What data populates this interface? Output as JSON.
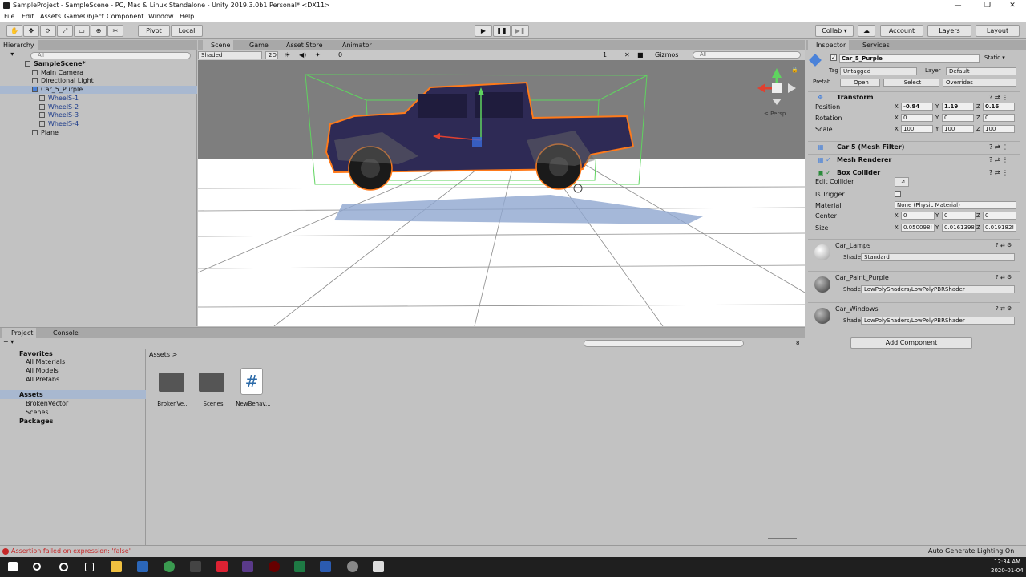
{
  "window": {
    "title": "SampleProject - SampleScene - PC, Mac & Linux Standalone - Unity 2019.3.0b1 Personal* <DX11>",
    "minimize": "—",
    "maximize": "❐",
    "close": "✕"
  },
  "menu": [
    "File",
    "Edit",
    "Assets",
    "GameObject",
    "Component",
    "Window",
    "Help"
  ],
  "toolbar": {
    "pivot": "Pivot",
    "local": "Local",
    "collab": "Collab ▾",
    "account": "Account",
    "layers": "Layers",
    "layout": "Layout"
  },
  "hierarchy": {
    "tab": "Hierarchy",
    "create": "+ ▾",
    "search_placeholder": "All",
    "items": [
      {
        "label": "SampleScene*",
        "depth": 0,
        "bold": true
      },
      {
        "label": "Main Camera",
        "depth": 1
      },
      {
        "label": "Directional Light",
        "depth": 1
      },
      {
        "label": "Car_5_Purple",
        "depth": 1,
        "selected": true
      },
      {
        "label": "WheelS-1",
        "depth": 2
      },
      {
        "label": "WheelS-2",
        "depth": 2
      },
      {
        "label": "WheelS-3",
        "depth": 2
      },
      {
        "label": "WheelS-4",
        "depth": 2
      },
      {
        "label": "Plane",
        "depth": 1
      }
    ]
  },
  "scene": {
    "tabs": [
      "Scene",
      "Game",
      "Asset Store",
      "Animator"
    ],
    "shading": "Shaded",
    "mode2d": "2D",
    "count": "0",
    "gizmos": "Gizmos",
    "search_placeholder": "All",
    "persp": "≤ Persp",
    "scale": "1"
  },
  "project": {
    "tabs": [
      "Project",
      "Console"
    ],
    "create": "+ ▾",
    "favorites": "Favorites",
    "fav_items": [
      "All Materials",
      "All Models",
      "All Prefabs"
    ],
    "assets": "Assets",
    "asset_items": [
      "BrokenVector",
      "Scenes"
    ],
    "packages": "Packages",
    "breadcrumb": "Assets >",
    "count": "8",
    "files": [
      {
        "name": "BrokenVe...",
        "type": "folder"
      },
      {
        "name": "Scenes",
        "type": "folder"
      },
      {
        "name": "NewBehav...",
        "type": "script"
      }
    ]
  },
  "inspector": {
    "tabs": [
      "Inspector",
      "Services"
    ],
    "object_name": "Car_5_Purple",
    "static": "Static ▾",
    "tag_label": "Tag",
    "tag_value": "Untagged",
    "layer_label": "Layer",
    "layer_value": "Default",
    "prefab_label": "Prefab",
    "open": "Open",
    "select": "Select",
    "overrides": "Overrides",
    "transform": {
      "title": "Transform",
      "position_label": "Position",
      "rotation_label": "Rotation",
      "scale_label": "Scale",
      "position": [
        "-0.84",
        "1.19",
        "0.16"
      ],
      "rotation": [
        "0",
        "0",
        "0"
      ],
      "scale": [
        "100",
        "100",
        "100"
      ]
    },
    "mesh_filter": "Car 5 (Mesh Filter)",
    "mesh_renderer": "Mesh Renderer",
    "box_collider": {
      "title": "Box Collider",
      "edit_collider": "Edit Collider",
      "is_trigger": "Is Trigger",
      "material_label": "Material",
      "material_value": "None (Physic Material)",
      "center_label": "Center",
      "center": [
        "0",
        "0",
        "0"
      ],
      "size_label": "Size",
      "size": [
        "0.050098!",
        "0.0161398",
        "0.019182!"
      ]
    },
    "materials": [
      {
        "name": "Car_Lamps",
        "shader": "Standard"
      },
      {
        "name": "Car_Paint_Purple",
        "shader": "LowPolyShaders/LowPolyPBRShader"
      },
      {
        "name": "Car_Windows",
        "shader": "LowPolyShaders/LowPolyPBRShader"
      }
    ],
    "shader_label": "Shader",
    "add_component": "Add Component"
  },
  "status": {
    "error": "Assertion failed on expression: 'false'",
    "right": "Auto Generate Lighting On"
  },
  "taskbar": {
    "time": "12:34 AM",
    "date": "2020-01-04"
  },
  "colors": {
    "selection_outline": "#ff7a1a",
    "car_body": "#2e2a55",
    "bounds": "#5fd45f",
    "error": "#c62828"
  }
}
